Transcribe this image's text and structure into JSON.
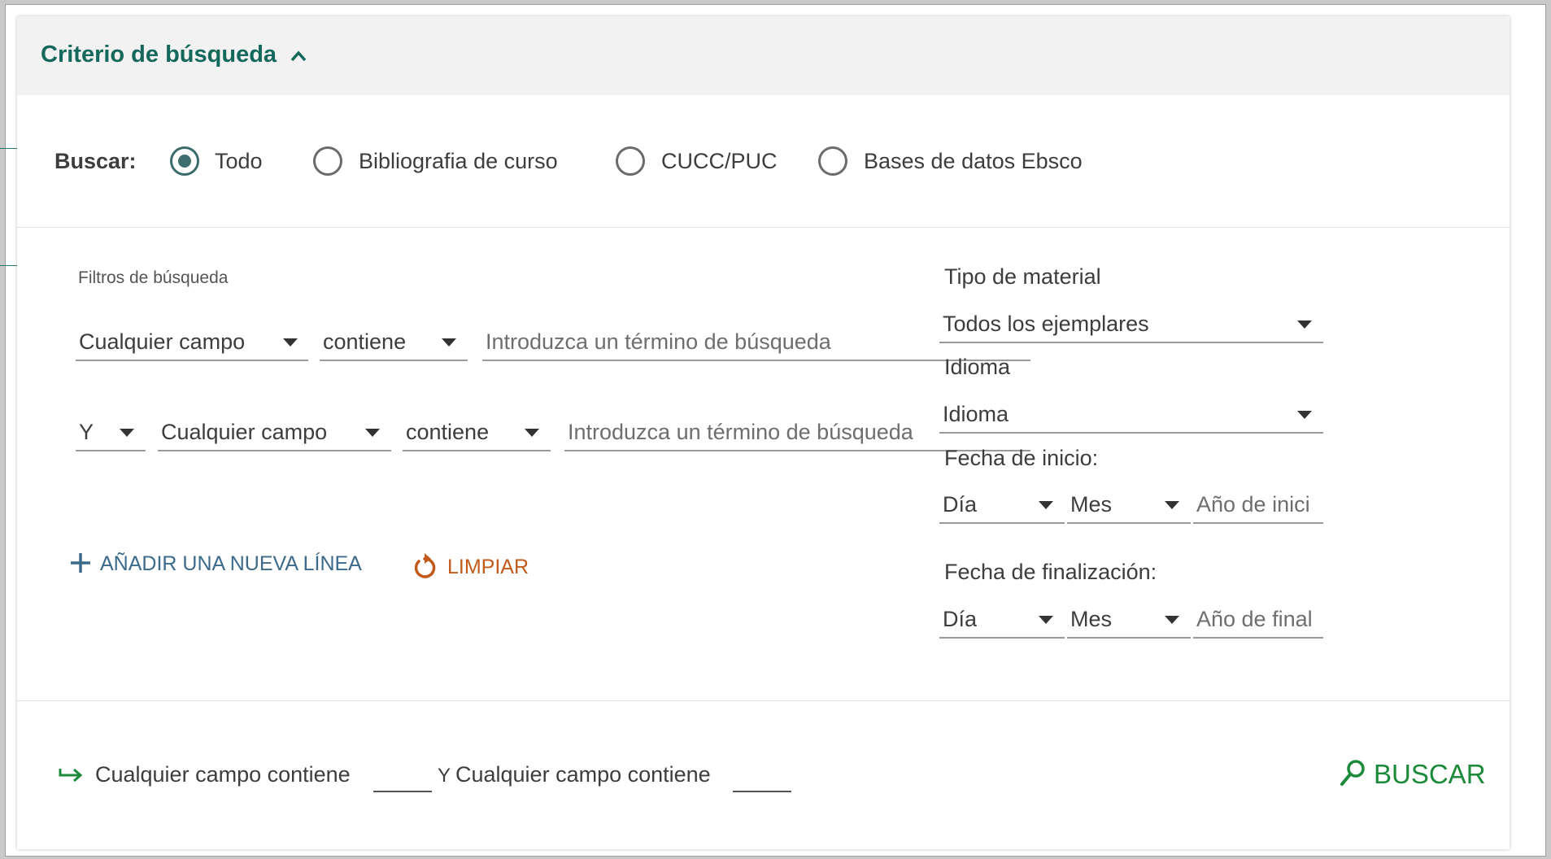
{
  "header": {
    "title": "Criterio de búsqueda"
  },
  "scope": {
    "label": "Buscar:",
    "options": [
      {
        "label": "Todo",
        "selected": true
      },
      {
        "label": "Bibliografia de curso",
        "selected": false
      },
      {
        "label": "CUCC/PUC",
        "selected": false
      },
      {
        "label": "Bases de datos Ebsco",
        "selected": false
      }
    ]
  },
  "filters": {
    "title": "Filtros de búsqueda",
    "row1": {
      "field": "Cualquier campo",
      "operator": "contiene",
      "placeholder": "Introduzca un término de búsqueda"
    },
    "row2": {
      "boolean": "Y",
      "field": "Cualquier campo",
      "operator": "contiene",
      "placeholder": "Introduzca un término de búsqueda"
    },
    "add_line": "AÑADIR UNA NUEVA LÍNEA",
    "clear": "LIMPIAR"
  },
  "side": {
    "material_label": "Tipo de material",
    "material_value": "Todos los ejemplares",
    "language_label": "Idioma",
    "language_value": "Idioma",
    "start_label": "Fecha de inicio:",
    "start_day": "Día",
    "start_month": "Mes",
    "start_year_placeholder": "Año de inici",
    "end_label": "Fecha de finalización:",
    "end_day": "Día",
    "end_month": "Mes",
    "end_year_placeholder": "Año de final"
  },
  "summary": {
    "part1": "Cualquier campo  contiene",
    "connector": "Y",
    "part2": "Cualquier campo  contiene"
  },
  "search_button": "BUSCAR",
  "colors": {
    "accent": "#15685c",
    "search": "#1c8a3a",
    "clear": "#c25a1a",
    "add": "#3c6a8a"
  }
}
